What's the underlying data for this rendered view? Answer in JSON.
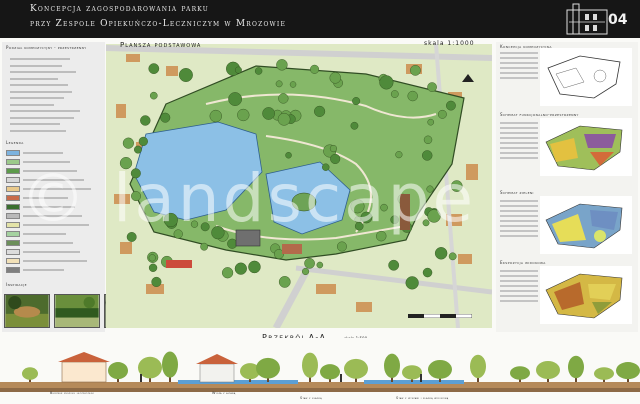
{
  "header": {
    "title_line1": "Koncepcja zagospodarowania parku",
    "title_line2": "przy Zespole Opiekuńczo-Leczniczym w Mrozowie",
    "sheet_number": "04"
  },
  "map": {
    "title": "Plansza podstawowa",
    "scale": "skala 1:1000"
  },
  "legend": {
    "section_heading": "Podział kompozycyjny - przestrzenny",
    "items_heading": "Legenda",
    "photos_heading": "Inspiracje",
    "swatch_colors": [
      "#7db3df",
      "#9bc98a",
      "#5d9b4b",
      "#d7d7d7",
      "#e9c98b",
      "#c86b4a",
      "#3a6e2f",
      "#b9b9b9",
      "#e3e3a8",
      "#a5d2a0",
      "#6c8f5a",
      "#dcdcdc",
      "#f2e1b8",
      "#7f7f7f"
    ]
  },
  "right_panel": {
    "heading1": "Koncepcja kompozycyjna",
    "heading2": "Schemat funkcjonalno-przestrzenny",
    "heading3": "Schemat zieleni",
    "heading4": "Ekspozycja widokowa"
  },
  "section": {
    "title": "Przekrój A-A",
    "scale": "skala 1:500",
    "labels": [
      "Budynek zespołu leczniczego",
      "Wyspa z altaną",
      "Staw z kładką",
      "Staw z wyspami i kładką widokową"
    ]
  },
  "watermark": "© landscape"
}
